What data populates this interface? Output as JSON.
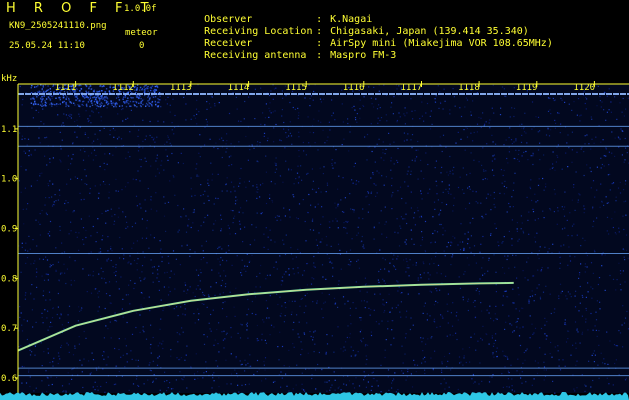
{
  "header": {
    "title": "H R O F F T",
    "version": "1.0.0f",
    "filename": "KN9_2505241110.png",
    "meteor_label": "meteor",
    "meteor_count": "0",
    "datetime": "25.05.24 11:10"
  },
  "info": [
    {
      "key": "Observer",
      "value": "K.Nagai"
    },
    {
      "key": "Receiving Location",
      "value": "Chigasaki, Japan (139.414 35.340)"
    },
    {
      "key": "Receiver",
      "value": "AirSpy mini (Miakejima VOR 108.65MHz)"
    },
    {
      "key": "Receiving antenna",
      "value": "Maspro FM-3"
    }
  ],
  "chart_data": {
    "type": "heatmap",
    "ylabel": "kHz",
    "y_ticks": [
      1.1,
      1.0,
      0.9,
      0.8,
      0.7,
      0.6
    ],
    "y_tick_labels": [
      "1.1",
      "1.0",
      "0.9",
      "0.8",
      "0.7",
      "0.6"
    ],
    "x_ticks": [
      1111,
      1112,
      1113,
      1114,
      1115,
      1116,
      1117,
      1118,
      1119,
      1120
    ],
    "x_tick_labels": [
      "1111",
      "1112",
      "1113",
      "1114",
      "1115",
      "1116",
      "1117",
      "1118",
      "1119",
      "1120"
    ],
    "horizontal_lines_khz": [
      1.17,
      1.105,
      1.065,
      0.85,
      0.62,
      0.605
    ],
    "meteor_trace": {
      "x": [
        1110.0,
        1111.0,
        1112.0,
        1113.0,
        1114.0,
        1115.0,
        1116.0,
        1117.0,
        1118.0,
        1118.6
      ],
      "y_khz": [
        0.655,
        0.705,
        0.735,
        0.755,
        0.768,
        0.777,
        0.783,
        0.787,
        0.79,
        0.791
      ]
    },
    "colors": {
      "background": "#000000",
      "noise": "#0a1a6a",
      "line": "#6aa8ff",
      "trace": "#8effb0",
      "text": "#ffff33",
      "bottom": "#33ddff"
    }
  }
}
